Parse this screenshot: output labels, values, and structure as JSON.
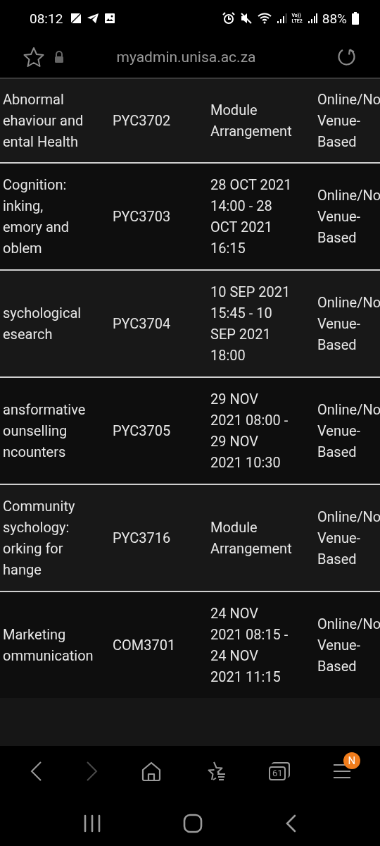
{
  "status_bar": {
    "time": "08:12",
    "volte_top": "Vo))",
    "volte_bottom": "LTE2",
    "battery": "88%"
  },
  "address_bar": {
    "url": "myadmin.unisa.ac.za"
  },
  "table": {
    "rows": [
      {
        "cells": [
          "Abnormal\nehaviour and\nental Health",
          "PYC3702",
          "Module\nArrangement",
          "Online/No\nVenue-\nBased"
        ]
      },
      {
        "cells": [
          "Cognition:\ninking,\nemory and\noblem",
          "PYC3703",
          "28 OCT 2021\n14:00 - 28\nOCT 2021\n16:15",
          "Online/No\nVenue-\nBased"
        ]
      },
      {
        "cells": [
          "sychological\nesearch",
          "PYC3704",
          "10 SEP 2021\n15:45 - 10\nSEP 2021\n18:00",
          "Online/No\nVenue-\nBased"
        ]
      },
      {
        "cells": [
          "ansformative\nounselling\nncounters",
          "PYC3705",
          "29 NOV\n2021 08:00 -\n29 NOV\n2021 10:30",
          "Online/No\nVenue-\nBased"
        ]
      },
      {
        "cells": [
          "Community\nsychology:\norking for\nhange",
          "PYC3716",
          "Module\nArrangement",
          "Online/No\nVenue-\nBased"
        ]
      },
      {
        "cells": [
          "Marketing\nommunication",
          "COM3701",
          "24 NOV\n2021 08:15 -\n24 NOV\n2021 11:15",
          "Online/No\nVenue-\nBased"
        ]
      }
    ]
  },
  "browser_toolbar": {
    "back": {
      "disabled": false
    },
    "forward": {
      "disabled": true
    },
    "tab_count": "61",
    "menu_badge": "N"
  }
}
